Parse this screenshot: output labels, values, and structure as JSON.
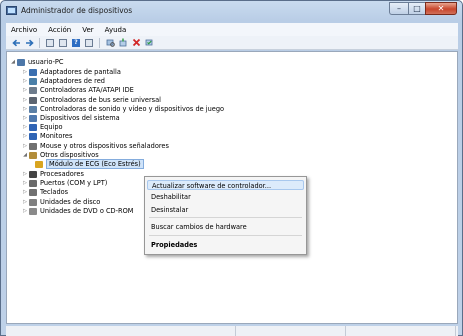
{
  "window": {
    "title": "Administrador de dispositivos",
    "min_glyph": "–",
    "max_glyph": "□",
    "close_glyph": "✕"
  },
  "menu": [
    "Archivo",
    "Acción",
    "Ver",
    "Ayuda"
  ],
  "toolbar": [
    "back-icon",
    "forward-icon",
    "properties-icon",
    "view-icon",
    "help-icon",
    "list-icon",
    "scan-icon",
    "update-driver-icon",
    "uninstall-icon",
    "enable-icon"
  ],
  "tree": {
    "root": "usuario-PC",
    "items": [
      {
        "label": "Adaptadores de pantalla",
        "icon": "display-adapter-icon",
        "color": "#3a6fb0"
      },
      {
        "label": "Adaptadores de red",
        "icon": "network-adapter-icon",
        "color": "#4a7fa8"
      },
      {
        "label": "Controladoras ATA/ATAPI IDE",
        "icon": "ide-controller-icon",
        "color": "#6e7c8c"
      },
      {
        "label": "Controladoras de bus serie universal",
        "icon": "usb-controller-icon",
        "color": "#5c6470"
      },
      {
        "label": "Controladoras de sonido y vídeo y dispositivos de juego",
        "icon": "sound-icon",
        "color": "#5b7fa5"
      },
      {
        "label": "Dispositivos del sistema",
        "icon": "system-devices-icon",
        "color": "#4f78ad"
      },
      {
        "label": "Equipo",
        "icon": "computer-icon",
        "color": "#2f64b5"
      },
      {
        "label": "Monitores",
        "icon": "monitor-icon",
        "color": "#2f64b5"
      },
      {
        "label": "Mouse y otros dispositivos señaladores",
        "icon": "mouse-icon",
        "color": "#707070"
      },
      {
        "label": "Otros dispositivos",
        "icon": "other-devices-icon",
        "color": "#b28d3a"
      },
      {
        "label": "Módulo de ECG (Eco Estrés)",
        "icon": "warning-device-icon",
        "color": "#d9a520"
      },
      {
        "label": "Procesadores",
        "icon": "processor-icon",
        "color": "#444444"
      },
      {
        "label": "Puertos (COM y LPT)",
        "icon": "port-icon",
        "color": "#6a6a6a"
      },
      {
        "label": "Teclados",
        "icon": "keyboard-icon",
        "color": "#707070"
      },
      {
        "label": "Unidades de disco",
        "icon": "disk-drive-icon",
        "color": "#808080"
      },
      {
        "label": "Unidades de DVD o CD-ROM",
        "icon": "dvd-drive-icon",
        "color": "#8a8a8a"
      }
    ]
  },
  "context_menu": {
    "update": "Actualizar software de controlador...",
    "disable": "Deshabilitar",
    "uninstall": "Desinstalar",
    "scan": "Buscar cambios de hardware",
    "properties": "Propiedades"
  }
}
